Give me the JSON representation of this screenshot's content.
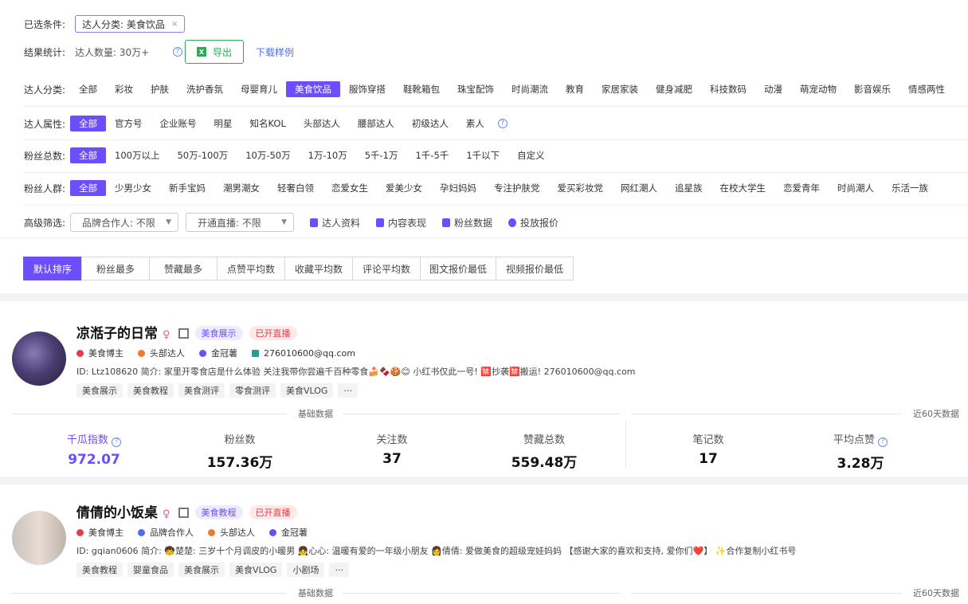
{
  "filters": {
    "selected_label": "已选条件:",
    "selected_chip": "达人分类: 美食饮品",
    "selected_chip_close": "×",
    "stats_label": "结果统计:",
    "stats_value": "达人数量: 30万+",
    "export_label": "导出",
    "download_sample": "下载样例",
    "category": {
      "label": "达人分类:",
      "options": [
        "全部",
        "彩妆",
        "护肤",
        "洗护香氛",
        "母婴育儿",
        "美食饮品",
        "服饰穿搭",
        "鞋靴箱包",
        "珠宝配饰",
        "时尚潮流",
        "教育",
        "家居家装",
        "健身减肥",
        "科技数码",
        "动漫",
        "萌宠动物",
        "影音娱乐",
        "情感两性"
      ],
      "active": 5
    },
    "attribute": {
      "label": "达人属性:",
      "options": [
        "全部",
        "官方号",
        "企业账号",
        "明星",
        "知名KOL",
        "头部达人",
        "腰部达人",
        "初级达人",
        "素人"
      ],
      "active": 0
    },
    "fans": {
      "label": "粉丝总数:",
      "options": [
        "全部",
        "100万以上",
        "50万-100万",
        "10万-50万",
        "1万-10万",
        "5千-1万",
        "1千-5千",
        "1千以下",
        "自定义"
      ],
      "active": 0
    },
    "crowd": {
      "label": "粉丝人群:",
      "options": [
        "全部",
        "少男少女",
        "新手宝妈",
        "潮男潮女",
        "轻奢白领",
        "恋爱女生",
        "爱美少女",
        "孕妇妈妈",
        "专注护肤党",
        "爱买彩妆党",
        "网红潮人",
        "追星族",
        "在校大学生",
        "恋爱青年",
        "时尚潮人",
        "乐活一族"
      ],
      "active": 0
    },
    "advanced": {
      "label": "高级筛选:",
      "brand_select": "品牌合作人: 不限",
      "live_select": "开通直播: 不限",
      "tools": [
        "达人资料",
        "内容表现",
        "粉丝数据",
        "投放报价"
      ]
    }
  },
  "sort": {
    "options": [
      "默认排序",
      "粉丝最多",
      "赞藏最多",
      "点赞平均数",
      "收藏平均数",
      "评论平均数",
      "图文报价最低",
      "视频报价最低"
    ],
    "active": 0
  },
  "cards": [
    {
      "name": "凉湉子的日常",
      "gender_icon": "♀",
      "tags": [
        "美食展示",
        "已开直播"
      ],
      "badges": [
        "美食博主",
        "头部达人",
        "金冠薯",
        "276010600@qq.com"
      ],
      "id_line": "ID: Ltz108620 简介: 家里开零食店是什么体验 关注我带你尝遍千百种零食🍰🍫🍪😊 小红书仅此一号! 🈲抄袭🈲搬运! 276010600@qq.com",
      "keywords": [
        "美食展示",
        "美食教程",
        "美食测评",
        "零食测评",
        "美食VLOG",
        "···"
      ],
      "section_title": "基础数据",
      "side_title": "近60天数据",
      "metrics": [
        {
          "label": "千瓜指数",
          "value": "972.07"
        },
        {
          "label": "粉丝数",
          "value": "157.36万"
        },
        {
          "label": "关注数",
          "value": "37"
        },
        {
          "label": "赞藏总数",
          "value": "559.48万"
        },
        {
          "label": "笔记数",
          "value": "17"
        },
        {
          "label": "平均点赞",
          "value": "3.28万"
        }
      ]
    },
    {
      "name": "倩倩的小饭桌",
      "gender_icon": "♀",
      "tags": [
        "美食教程",
        "已开直播"
      ],
      "badges": [
        "美食博主",
        "品牌合作人",
        "头部达人",
        "金冠薯"
      ],
      "id_line": "ID: gqian0606 简介: 🧒楚楚: 三岁十个月调皮的小暖男 👧心心: 温暖有爱的一年级小朋友 👩倩倩: 爱做美食的超级宠娃妈妈 【感谢大家的喜欢和支持, 爱你们❤️】 ✨合作复制小红书号",
      "keywords": [
        "美食教程",
        "婴童食品",
        "美食展示",
        "美食VLOG",
        "小剧场",
        "···"
      ],
      "section_title": "基础数据",
      "side_title": "近60天数据"
    }
  ],
  "colors": {
    "accent": "#6c4dff",
    "export_green": "#2eaa57",
    "link_blue": "#4a6cf7",
    "live_red": "#e0404a"
  }
}
